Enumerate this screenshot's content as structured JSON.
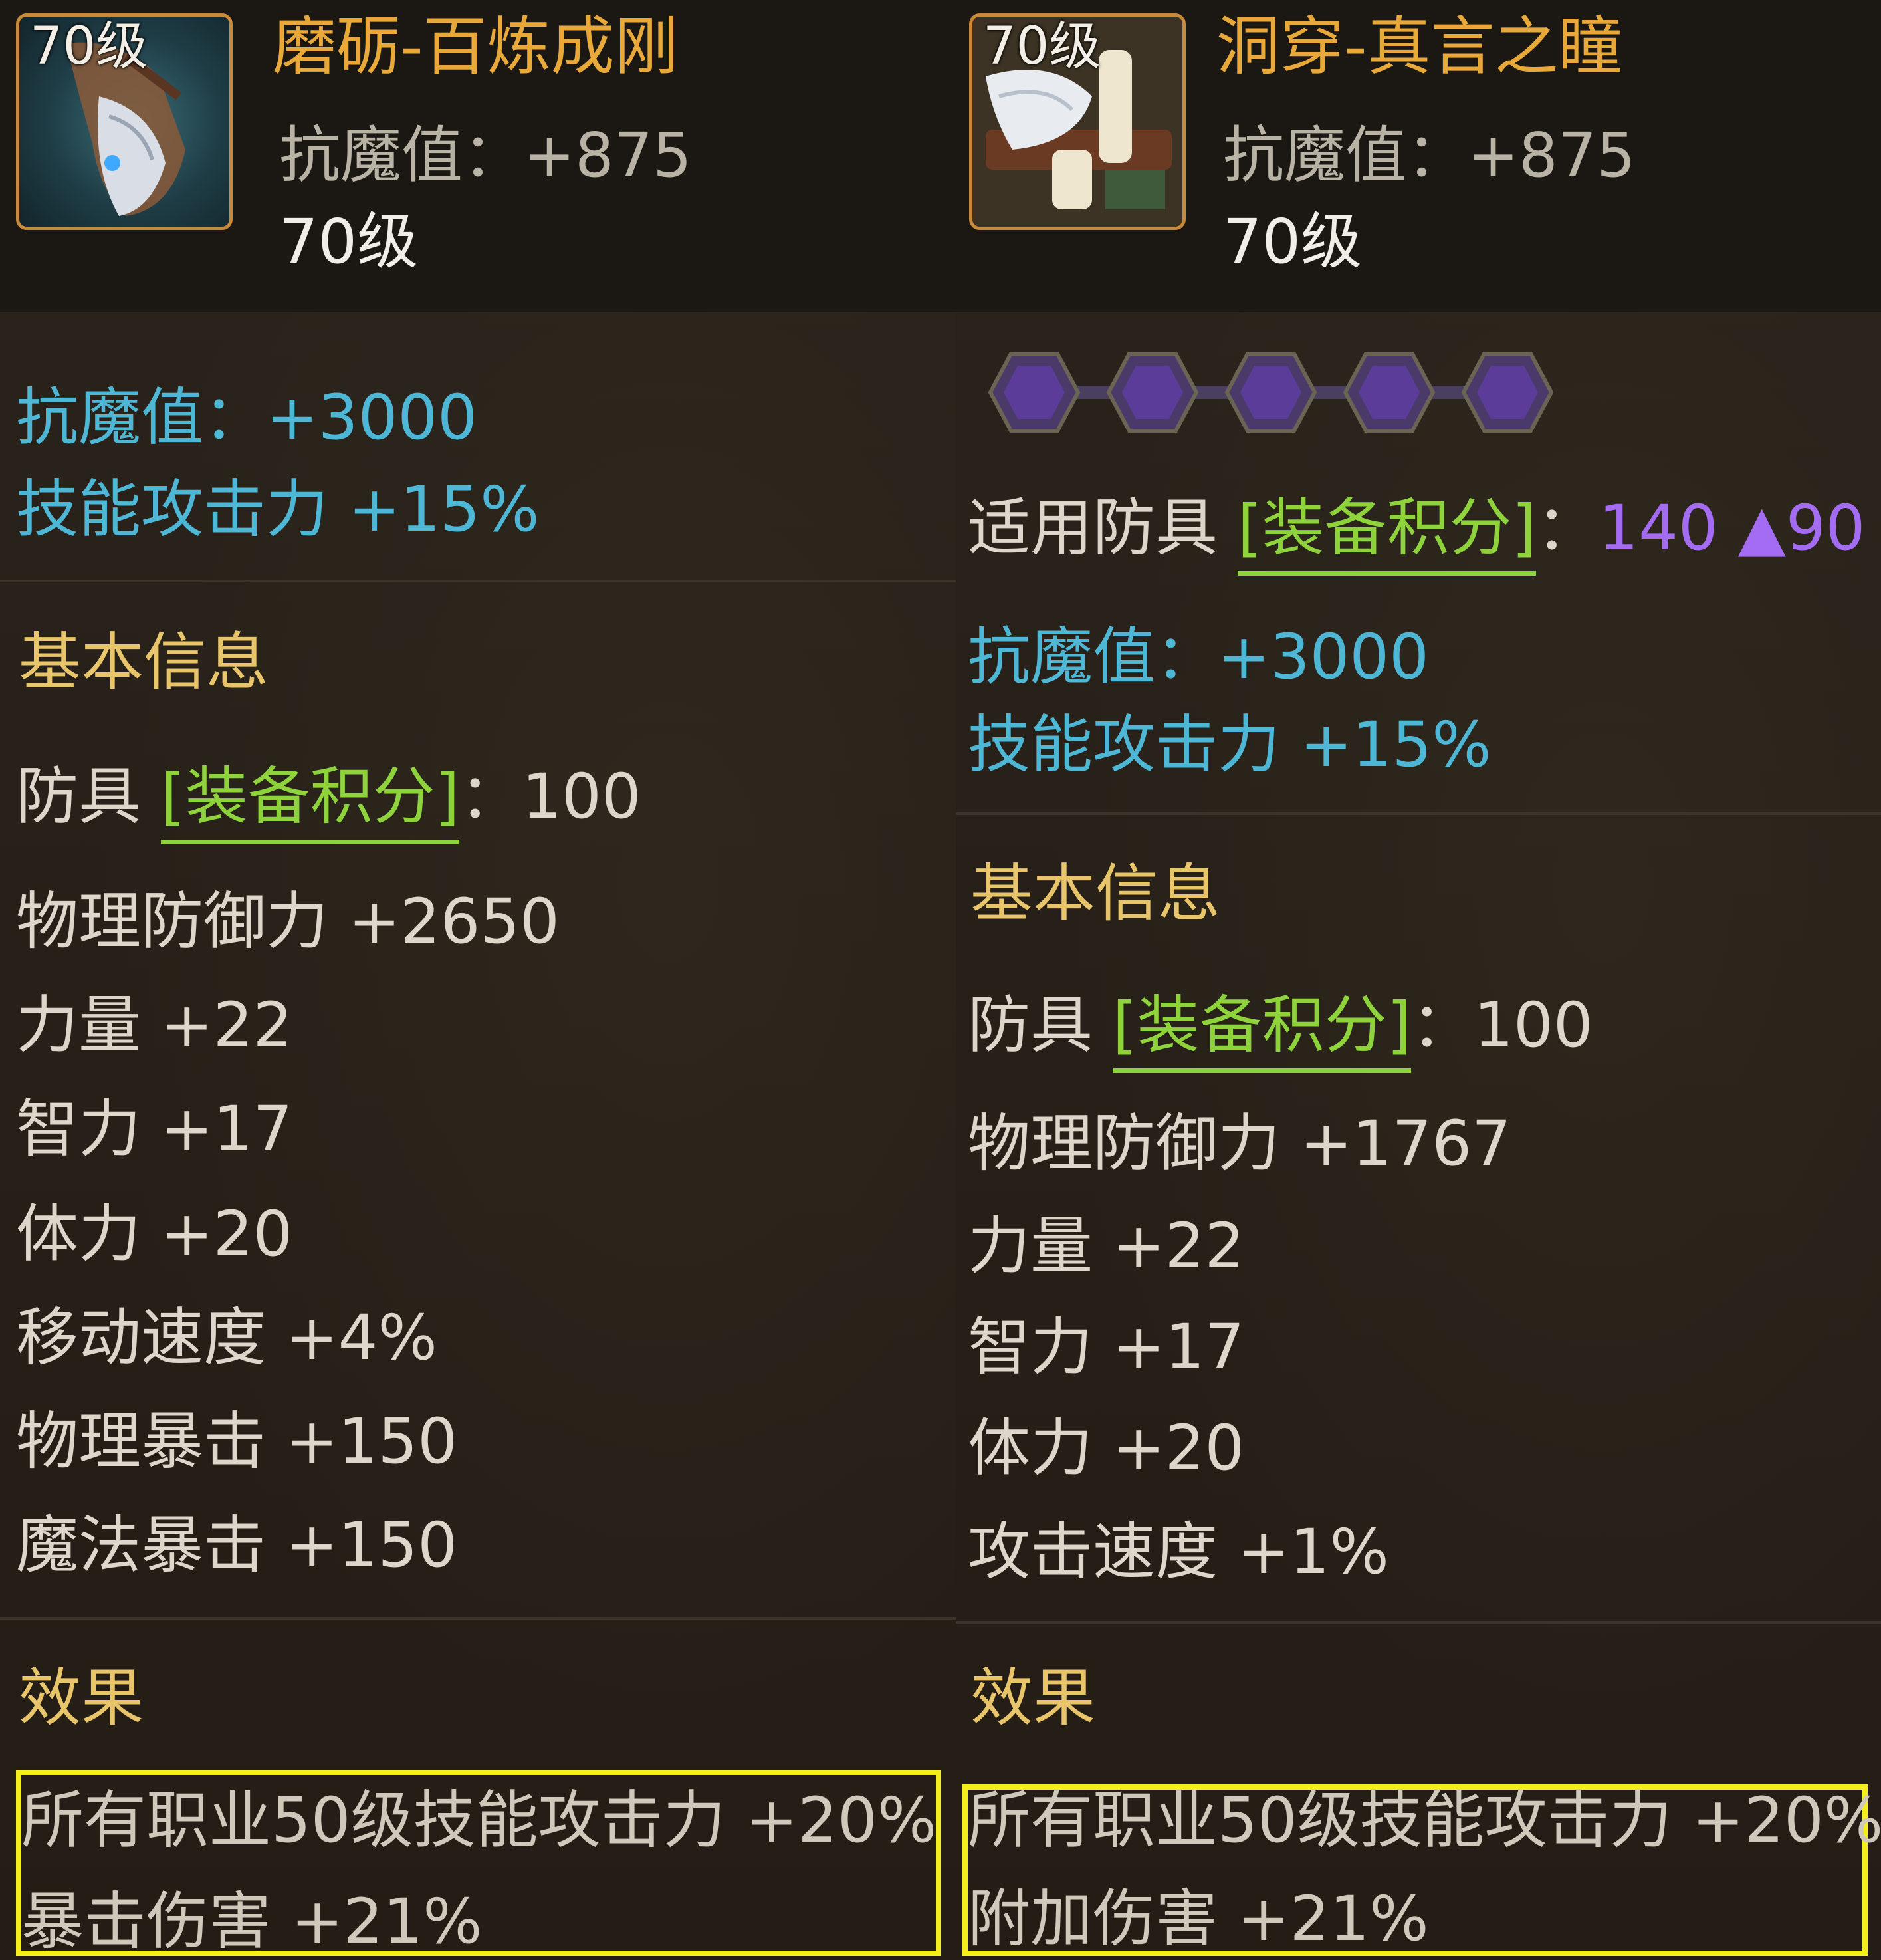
{
  "left": {
    "icon_level": "70级",
    "name": "磨砺-百炼成刚",
    "header_stat": "抗魔值：+875",
    "level": "70级",
    "stats_top": [
      "抗魔值：+3000",
      "技能攻击力 +15%"
    ],
    "section_basic": "基本信息",
    "score_prefix": "防具 ",
    "score_tag": "[装备积分]",
    "score_value": "：100",
    "basic_lines": [
      "物理防御力 +2650",
      "力量 +22",
      "智力 +17",
      "体力 +20",
      "移动速度 +4%",
      "物理暴击 +150",
      "魔法暴击 +150"
    ],
    "section_effect": "效果",
    "effects": [
      "所有职业50级技能攻击力 +20%",
      "暴击伤害 +21%"
    ]
  },
  "right": {
    "icon_level": "70级",
    "name": "洞穿-真言之瞳",
    "header_stat": "抗魔值：+875",
    "level": "70级",
    "gem_count": 5,
    "applicable_prefix": "适用防具 ",
    "applicable_tag": "[装备积分]",
    "applicable_colon": "：",
    "applicable_value": "140 ▲90",
    "stats_top": [
      "抗魔值：+3000",
      "技能攻击力 +15%"
    ],
    "section_basic": "基本信息",
    "score_prefix": "防具 ",
    "score_tag": "[装备积分]",
    "score_value": "：100",
    "basic_lines": [
      "物理防御力 +1767",
      "力量 +22",
      "智力 +17",
      "体力 +20",
      "攻击速度 +1%"
    ],
    "section_effect": "效果",
    "effects": [
      "所有职业50级技能攻击力 +20%",
      "附加伤害 +21%"
    ]
  },
  "colors": {
    "name": "#e8a93a",
    "cyan_stat": "#4fb7d6",
    "section": "#e8c56a",
    "tag_green": "#8fd33c",
    "score_purple": "#a46cf2",
    "highlight_box": "#f4ef1a",
    "icon_border": "#c9893a"
  },
  "icons": {
    "left_item": "bracer-armor-icon",
    "right_item": "belt-scrolls-armor-icon",
    "gem": "purple-hexagon-gem-socket-icon"
  }
}
